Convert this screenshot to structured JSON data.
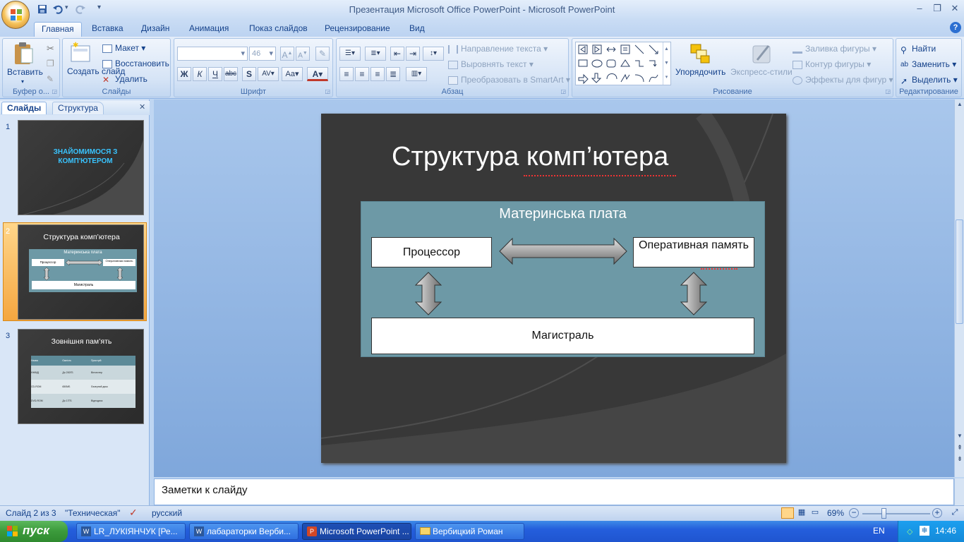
{
  "window": {
    "title": "Презентация Microsoft Office PowerPoint - Microsoft PowerPoint"
  },
  "ribbon_tabs": [
    "Главная",
    "Вставка",
    "Дизайн",
    "Анимация",
    "Показ слайдов",
    "Рецензирование",
    "Вид"
  ],
  "ribbon": {
    "clipboard": {
      "label": "Буфер о...",
      "paste": "Вставить"
    },
    "slides": {
      "label": "Слайды",
      "new_slide": "Создать слайд",
      "layout": "Макет",
      "reset": "Восстановить",
      "delete": "Удалить"
    },
    "font": {
      "label": "Шрифт",
      "size": "46"
    },
    "paragraph": {
      "label": "Абзац",
      "text_direction": "Направление текста",
      "align_text": "Выровнять текст",
      "smartart": "Преобразовать в SmartArt"
    },
    "drawing": {
      "label": "Рисование",
      "arrange": "Упорядочить",
      "quick_styles": "Экспресс-стили",
      "shape_fill": "Заливка фигуры",
      "shape_outline": "Контур фигуры",
      "shape_effects": "Эффекты для фигур"
    },
    "editing": {
      "label": "Редактирование",
      "find": "Найти",
      "replace": "Заменить",
      "select": "Выделить"
    }
  },
  "left_panel": {
    "tabs": [
      "Слайды",
      "Структура"
    ],
    "slides": [
      {
        "num": "1",
        "title": "ЗНАЙОМИМОСЯ З КОМП'ЮТЕРОМ"
      },
      {
        "num": "2",
        "title": "Структура  комп’ютера",
        "mini_board": "Материнська плата",
        "mini_cpu": "Процессор",
        "mini_ram": "Оперативная память",
        "mini_bus": "Магистраль"
      },
      {
        "num": "3",
        "title": "Зовнішня пам’ять",
        "table": [
          [
            "Назва",
            "Ємність",
            "Пристрій"
          ],
          [
            "НЖМД",
            "До 200ГБ",
            "Вінчестер"
          ],
          [
            "CD-ROM",
            "650МБ",
            "Лазерний диск"
          ],
          [
            "DVD-ROM",
            "До 17ГБ",
            "Відеодиск"
          ]
        ]
      }
    ]
  },
  "slide": {
    "title": "Структура  комп’ютера",
    "board_label": "Материнська плата",
    "cpu": "Процессор",
    "ram": "Оперативная память",
    "bus": "Магистраль"
  },
  "notes": {
    "placeholder": "Заметки к слайду"
  },
  "status": {
    "slide": "Слайд 2 из 3",
    "theme": "\"Техническая\"",
    "language": "русский",
    "zoom": "69%"
  },
  "taskbar": {
    "start": "пуск",
    "tasks": [
      "LR_ЛУКІЯНЧУК [Ре...",
      "лабараторки Верби...",
      "Microsoft PowerPoint ...",
      "Вербицкий Роман"
    ],
    "lang": "EN",
    "time": "14:46"
  }
}
